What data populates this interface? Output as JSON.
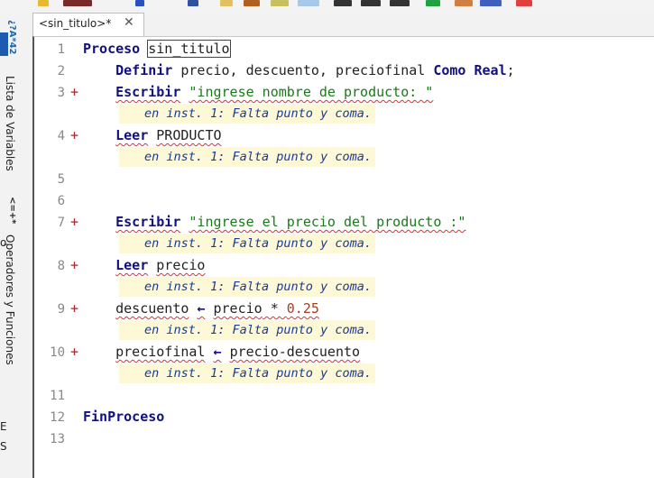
{
  "tab": {
    "label": "<sin_titulo>*",
    "close": "✕"
  },
  "sidebar": {
    "panel_variables": "Lista de Variables",
    "panel_variables_symbol": "¿?A*42",
    "panel_operators": "Operadores y Funciones",
    "panel_operators_symbol": "<=+*",
    "cut_char_1": "o",
    "cut_char_2": "E",
    "cut_char_3": "S"
  },
  "editor": {
    "lines": [
      {
        "n": "1",
        "marker": "",
        "tokens": [
          {
            "t": "Proceso",
            "c": "kw"
          },
          {
            "t": " "
          },
          {
            "t": "sin_titulo",
            "c": "box"
          }
        ]
      },
      {
        "n": "2",
        "marker": "",
        "tokens": [
          {
            "t": "    "
          },
          {
            "t": "Definir",
            "c": "kw"
          },
          {
            "t": " precio, descuento, preciofinal "
          },
          {
            "t": "Como Real",
            "c": "kw"
          },
          {
            "t": ";"
          }
        ]
      },
      {
        "n": "3",
        "marker": "+",
        "tokens": [
          {
            "t": "    "
          },
          {
            "t": "Escribir",
            "c": "kw err"
          },
          {
            "t": " "
          },
          {
            "t": "\"ingrese nombre de producto: \"",
            "c": "str err"
          }
        ],
        "note": "en inst. 1: Falta punto y coma."
      },
      {
        "n": "4",
        "marker": "+",
        "tokens": [
          {
            "t": "    "
          },
          {
            "t": "Leer",
            "c": "kw err"
          },
          {
            "t": " "
          },
          {
            "t": "PRODUCTO",
            "c": "err"
          }
        ],
        "note": "en inst. 1: Falta punto y coma."
      },
      {
        "n": "5",
        "marker": "",
        "tokens": []
      },
      {
        "n": "6",
        "marker": "",
        "tokens": []
      },
      {
        "n": "7",
        "marker": "+",
        "tokens": [
          {
            "t": "    "
          },
          {
            "t": "Escribir",
            "c": "kw err"
          },
          {
            "t": " "
          },
          {
            "t": "\"ingrese el precio del producto :\"",
            "c": "str err"
          }
        ],
        "note": "en inst. 1: Falta punto y coma."
      },
      {
        "n": "8",
        "marker": "+",
        "tokens": [
          {
            "t": "    "
          },
          {
            "t": "Leer",
            "c": "kw err"
          },
          {
            "t": " "
          },
          {
            "t": "precio",
            "c": "err"
          }
        ],
        "note": "en inst. 1: Falta punto y coma."
      },
      {
        "n": "9",
        "marker": "+",
        "tokens": [
          {
            "t": "    "
          },
          {
            "t": "descuento",
            "c": "err"
          },
          {
            "t": " "
          },
          {
            "t": "←",
            "c": "kw err"
          },
          {
            "t": " "
          },
          {
            "t": "precio",
            "c": "err"
          },
          {
            "t": " * ",
            "c": "err"
          },
          {
            "t": "0.25",
            "c": "num err"
          }
        ],
        "note": "en inst. 1: Falta punto y coma."
      },
      {
        "n": "10",
        "marker": "+",
        "tokens": [
          {
            "t": "    "
          },
          {
            "t": "preciofinal",
            "c": "err"
          },
          {
            "t": " "
          },
          {
            "t": "←",
            "c": "kw err"
          },
          {
            "t": " "
          },
          {
            "t": "precio-descuento",
            "c": "err"
          }
        ],
        "note": "en inst. 1: Falta punto y coma."
      },
      {
        "n": "11",
        "marker": "",
        "tokens": []
      },
      {
        "n": "12",
        "marker": "",
        "tokens": [
          {
            "t": "FinProceso",
            "c": "kw"
          }
        ]
      },
      {
        "n": "13",
        "marker": "",
        "tokens": []
      }
    ]
  },
  "colors": {
    "keyword": "#101080",
    "string": "#1a7a1a",
    "number": "#a04020",
    "error_marker": "#b22222",
    "note_bg": "#fdf8d5",
    "note_text": "#1a3a99"
  }
}
